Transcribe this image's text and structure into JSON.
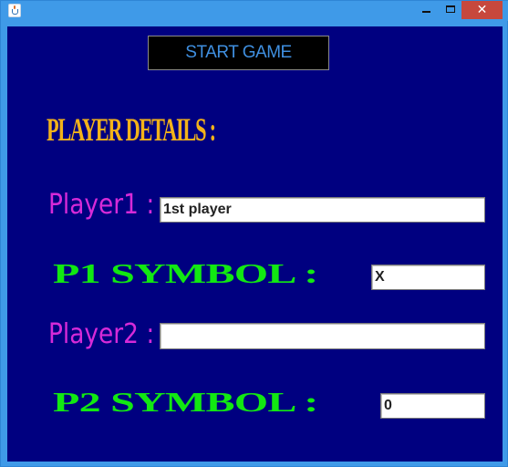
{
  "window": {
    "title": "",
    "controls": {
      "minimize": "minimize",
      "maximize": "maximize",
      "close": "✕"
    }
  },
  "toolbar": {
    "start_label": "START GAME"
  },
  "details": {
    "title": "PLAYER DETAILS :",
    "player1": {
      "label": "Player1 :",
      "value": "1st player",
      "placeholder": ""
    },
    "p1_symbol": {
      "label": "P1 SYMBOL :",
      "value": "X"
    },
    "player2": {
      "label": "Player2 :",
      "value": "",
      "placeholder": ""
    },
    "p2_symbol": {
      "label": "P2 SYMBOL :",
      "value": "0"
    }
  },
  "colors": {
    "background": "#000080",
    "title_accent": "#f2b21a",
    "player_label": "#d62ad8",
    "symbol_label": "#12e812",
    "button_text": "#3f8fe0"
  },
  "icons": [
    "java-cup-icon",
    "minimize-icon",
    "maximize-icon",
    "close-icon"
  ]
}
